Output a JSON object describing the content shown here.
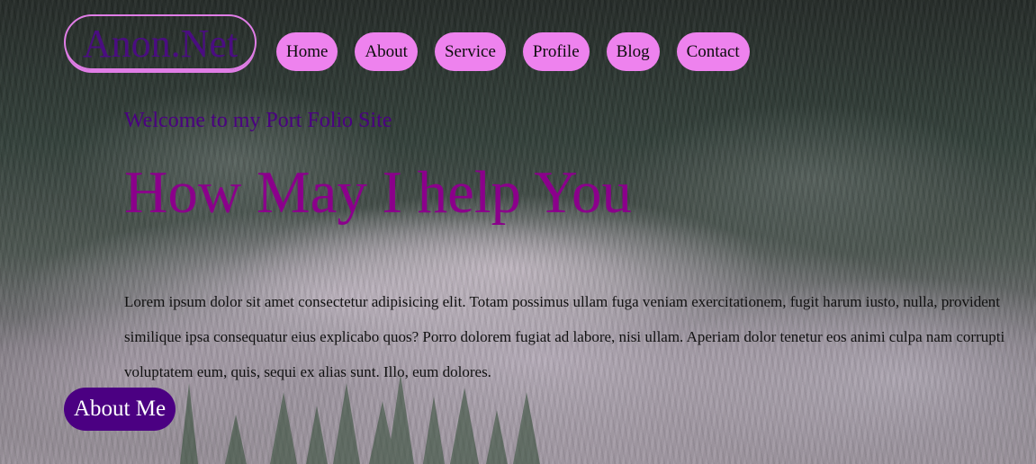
{
  "logo": {
    "text": "Anon.Net"
  },
  "nav": {
    "items": [
      {
        "label": "Home"
      },
      {
        "label": "About"
      },
      {
        "label": "Service"
      },
      {
        "label": "Profile"
      },
      {
        "label": "Blog"
      },
      {
        "label": "Contact"
      }
    ]
  },
  "hero": {
    "welcome": "Welcome to my Port Folio Site",
    "headline": "How May I help You",
    "paragraph": "Lorem ipsum dolor sit amet consectetur adipisicing elit. Totam possimus ullam fuga veniam exercitationem, fugit harum iusto, nulla, provident similique ipsa consequatur eius explicabo quos? Porro dolorem fugiat ad labore, nisi ullam. Aperiam dolor tenetur eos animi culpa nam corrupti voluptatem eum, quis, sequi ex alias sunt. Illo, eum dolores.",
    "cta_label": "About Me"
  },
  "colors": {
    "nav_button": "#ee82ee",
    "logo_text": "#4b0082",
    "logo_border": "#e07de6",
    "welcome_text": "#4b0082",
    "headline_text": "#8b008b",
    "cta_background": "#4b0082",
    "cta_text": "#ffffff"
  }
}
